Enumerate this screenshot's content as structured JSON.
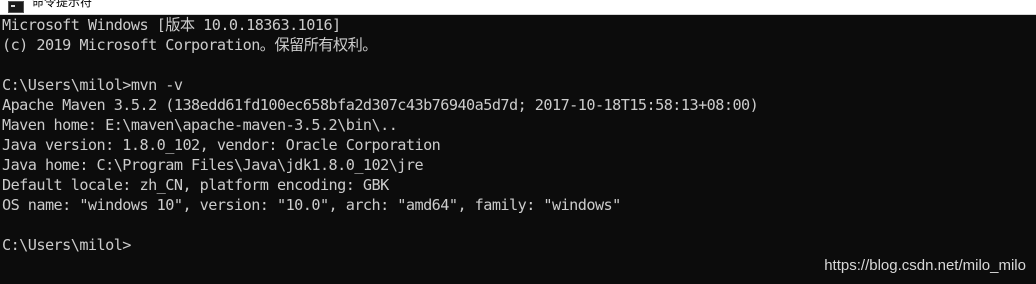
{
  "window": {
    "title": "命令提示符"
  },
  "console": {
    "lines": [
      "Microsoft Windows [版本 10.0.18363.1016]",
      "(c) 2019 Microsoft Corporation。保留所有权利。",
      "",
      "C:\\Users\\milol>mvn -v",
      "Apache Maven 3.5.2 (138edd61fd100ec658bfa2d307c43b76940a5d7d; 2017-10-18T15:58:13+08:00)",
      "Maven home: E:\\maven\\apache-maven-3.5.2\\bin\\..",
      "Java version: 1.8.0_102, vendor: Oracle Corporation",
      "Java home: C:\\Program Files\\Java\\jdk1.8.0_102\\jre",
      "Default locale: zh_CN, platform encoding: GBK",
      "OS name: \"windows 10\", version: \"10.0\", arch: \"amd64\", family: \"windows\"",
      "",
      "C:\\Users\\milol>"
    ]
  },
  "watermark": {
    "text": "https://blog.csdn.net/milo_milo"
  },
  "colors": {
    "background": "#0c0c0c",
    "foreground": "#cccccc",
    "titlebar": "#ffffff"
  }
}
